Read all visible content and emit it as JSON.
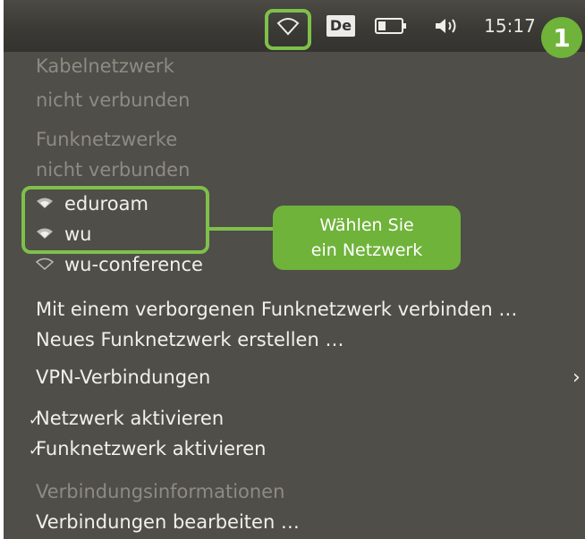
{
  "panel": {
    "keyboard_layout": "De",
    "clock": "15:17",
    "icons": [
      "wifi-icon",
      "battery-icon",
      "volume-icon"
    ]
  },
  "badge": "1",
  "menu": {
    "wired_header": "Kabelnetzwerk",
    "wired_status": "nicht verbunden",
    "wireless_header": "Funknetzwerke",
    "wireless_status": "nicht verbunden",
    "networks": [
      {
        "name": "eduroam"
      },
      {
        "name": "wu"
      },
      {
        "name": "wu-conference"
      }
    ],
    "connect_hidden": "Mit einem verborgenen Funknetzwerk verbinden …",
    "create_new": "Neues Funknetzwerk erstellen …",
    "vpn": "VPN-Verbindungen",
    "enable_networking": "Netzwerk aktivieren",
    "enable_wireless": "Funknetzwerk aktivieren",
    "connection_info": "Verbindungsinformationen",
    "edit_connections": "Verbindungen bearbeiten …"
  },
  "callout": {
    "line1": "Wählen Sie",
    "line2": "ein Netzwerk"
  },
  "colors": {
    "accent": "#7fc04a",
    "menu_bg": "#4f4e49",
    "panel_bg": "#3a3934"
  }
}
